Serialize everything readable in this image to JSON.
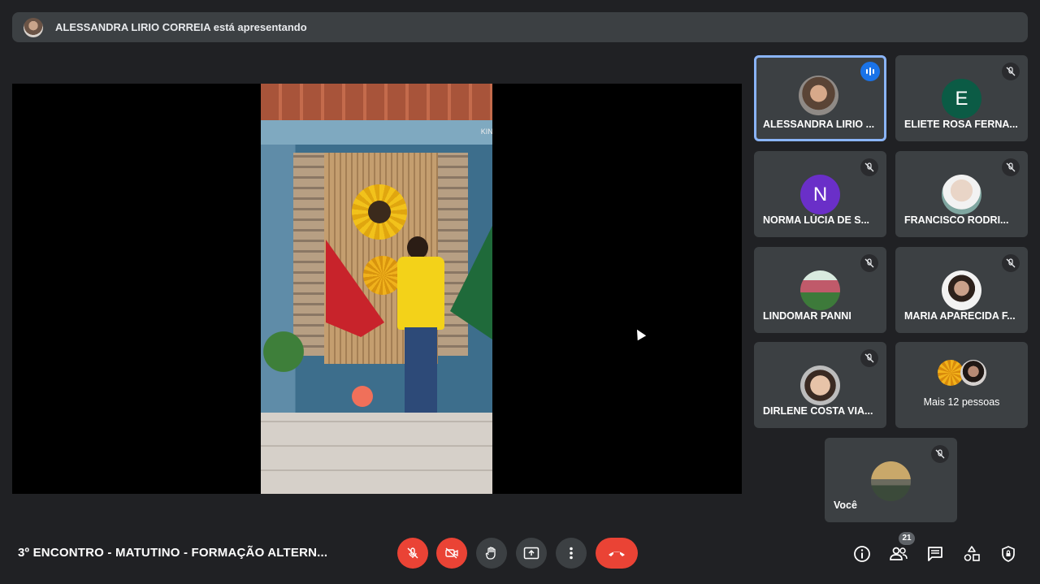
{
  "presenter": {
    "text": "ALESSANDRA LIRIO CORREIA está apresentando"
  },
  "video": {
    "watermark": "KINEMASTER",
    "watermark_glyph": "K"
  },
  "participants": [
    {
      "name": "ALESSANDRA LIRIO ...",
      "status": "speaking"
    },
    {
      "name": "ELIETE ROSA FERNA...",
      "initial": "E",
      "avatar_color": "#0b5b45",
      "status": "muted"
    },
    {
      "name": "NORMA LÚCIA DE S...",
      "initial": "N",
      "avatar_color": "#6a2fc8",
      "status": "muted"
    },
    {
      "name": "FRANCISCO RODRI...",
      "status": "muted"
    },
    {
      "name": "LINDOMAR PANNI",
      "status": "muted"
    },
    {
      "name": "MARIA APARECIDA F...",
      "status": "muted"
    },
    {
      "name": "DIRLENE COSTA VIA...",
      "status": "muted"
    }
  ],
  "more": {
    "label": "Mais 12 pessoas"
  },
  "self": {
    "name": "Você",
    "status": "muted"
  },
  "meeting": {
    "title": "3º ENCONTRO - MATUTINO - FORMAÇÃO ALTERN..."
  },
  "people_count": "21",
  "colors": {
    "background": "#202124",
    "tile": "#3c4043",
    "accent": "#8ab4f8",
    "danger": "#ea4335",
    "speaking": "#1a73e8"
  }
}
